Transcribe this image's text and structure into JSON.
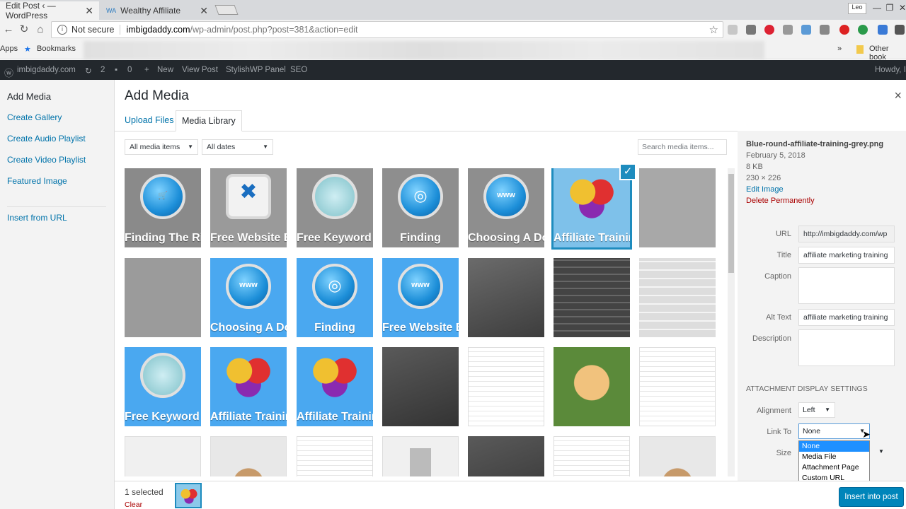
{
  "browser": {
    "tabs": [
      {
        "title": "Edit Post ‹ — WordPress",
        "close": "✕"
      },
      {
        "title": "Wealthy Affiliate",
        "close": "✕"
      }
    ],
    "window_badge": "Leo",
    "security_label": "Not secure",
    "url_host": "imbigdaddy.com",
    "url_path": "/wp-admin/post.php?post=381&action=edit",
    "bookmarks": {
      "apps": "Apps",
      "bookmarks": "Bookmarks",
      "more": "»",
      "other": "Other book"
    }
  },
  "adminbar": {
    "site": "imbigdaddy.com",
    "updates": "2",
    "comments": "0",
    "new": "New",
    "view_post": "View Post",
    "stylish": "StylishWP Panel",
    "seo": "SEO",
    "howdy": "Howdy, I"
  },
  "modal": {
    "title": "Add Media",
    "close": "×",
    "menu": [
      "Add Media",
      "Create Gallery",
      "Create Audio Playlist",
      "Create Video Playlist",
      "Featured Image",
      "Insert from URL"
    ],
    "router_tabs": [
      "Upload Files",
      "Media Library"
    ],
    "filters": {
      "type": "All media items",
      "dates": "All dates"
    },
    "search_placeholder": "Search media items...",
    "grid_labels": {
      "r0c0": "Finding The Right Product",
      "r0c1": "Free Website Builder",
      "r0c2": "Free Keyword Tool",
      "r0c3": "Finding",
      "r0c4": "Choosing A Domain",
      "r0c5": "Affiliate Training",
      "r1c1": "Choosing A Domain",
      "r1c2": "Finding",
      "r1c3": "Free Website Builder",
      "r2c0": "Free Keyword Tool",
      "r2c1": "Affiliate Training",
      "r2c2": "Affiliate Training",
      "www": "www"
    },
    "check_mark": "✓"
  },
  "details": {
    "filename": "Blue-round-affiliate-training-grey.png",
    "date": "February 5, 2018",
    "size": "8 KB",
    "dimensions": "230 × 226",
    "edit_image": "Edit Image",
    "delete": "Delete Permanently",
    "url_label": "URL",
    "url_value": "http://imbigdaddy.com/wp",
    "title_label": "Title",
    "title_value": "affiliate marketing training",
    "caption_label": "Caption",
    "alt_label": "Alt Text",
    "alt_value": "affiliate marketing training",
    "description_label": "Description",
    "settings_title": "Attachment Display Settings",
    "alignment_label": "Alignment",
    "alignment_value": "Left",
    "link_label": "Link To",
    "link_value": "None",
    "size_label": "Size",
    "link_options": [
      "None",
      "Media File",
      "Attachment Page",
      "Custom URL"
    ]
  },
  "footer": {
    "selected": "1 selected",
    "clear": "Clear",
    "insert": "Insert into post"
  },
  "colors": {
    "accent": "#0073aa",
    "button": "#0085ba",
    "danger": "#a00",
    "adminbar": "#23282d",
    "tile_blue": "#4aa8f0"
  }
}
